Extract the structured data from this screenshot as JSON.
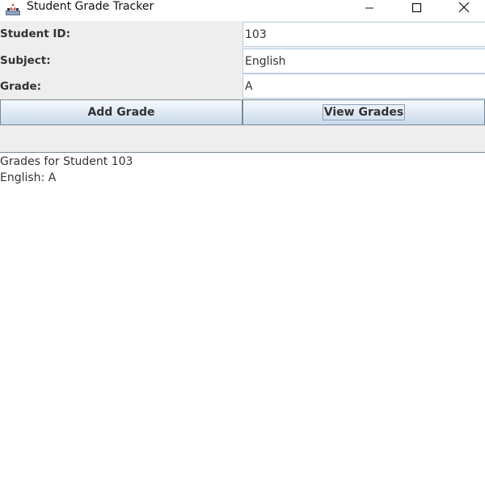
{
  "window": {
    "title": "Student Grade Tracker"
  },
  "form": {
    "student_id_label": "Student ID:",
    "student_id_value": "103",
    "subject_label": "Subject:",
    "subject_value": "English",
    "grade_label": "Grade:",
    "grade_value": "A",
    "add_button_label": "Add Grade",
    "view_button_label": "View Grades"
  },
  "output": {
    "lines": [
      "Grades for Student 103",
      "English: A"
    ]
  },
  "icons": {
    "app": "java-coffee-cup-icon",
    "minimize": "minimize-icon",
    "maximize": "maximize-icon",
    "close": "close-icon"
  }
}
